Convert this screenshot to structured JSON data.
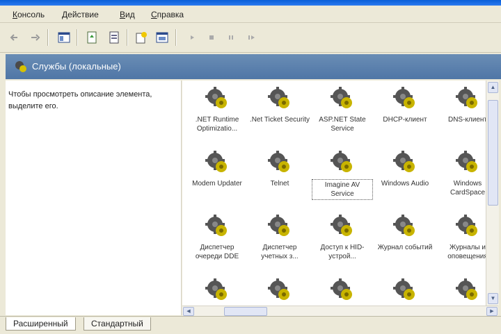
{
  "menu": [
    "Консоль",
    "Действие",
    "Вид",
    "Справка"
  ],
  "header": {
    "title": "Службы (локальные)",
    "icon": "services-gear-icon"
  },
  "left_pane": {
    "description": "Чтобы просмотреть описание элемента, выделите его."
  },
  "services": [
    {
      "label": ".NET Runtime Optimizatio..."
    },
    {
      "label": ".Net Ticket Security"
    },
    {
      "label": "ASP.NET State Service"
    },
    {
      "label": "DHCP-клиент"
    },
    {
      "label": "DNS-клиент"
    },
    {
      "label": "Modem Updater"
    },
    {
      "label": "Telnet"
    },
    {
      "label": "Imagine AV Service"
    },
    {
      "label": "Windows Audio"
    },
    {
      "label": "Windows CardSpace"
    },
    {
      "label": "Диспетчер очереди DDE"
    },
    {
      "label": "Диспетчер учетных з..."
    },
    {
      "label": "Доступ к HID-устрой..."
    },
    {
      "label": "Журнал событий"
    },
    {
      "label": "Журналы и оповещения"
    },
    {
      "label": ""
    },
    {
      "label": ""
    },
    {
      "label": ""
    },
    {
      "label": ""
    },
    {
      "label": ""
    }
  ],
  "selected_service_index": 7,
  "tabs": [
    {
      "label": "Расширенный",
      "active": true
    },
    {
      "label": "Стандартный",
      "active": false
    }
  ],
  "colors": {
    "header_bg": "#5a7fad",
    "gear_dark": "#5a5a5a",
    "gear_yellow": "#c8b400"
  }
}
